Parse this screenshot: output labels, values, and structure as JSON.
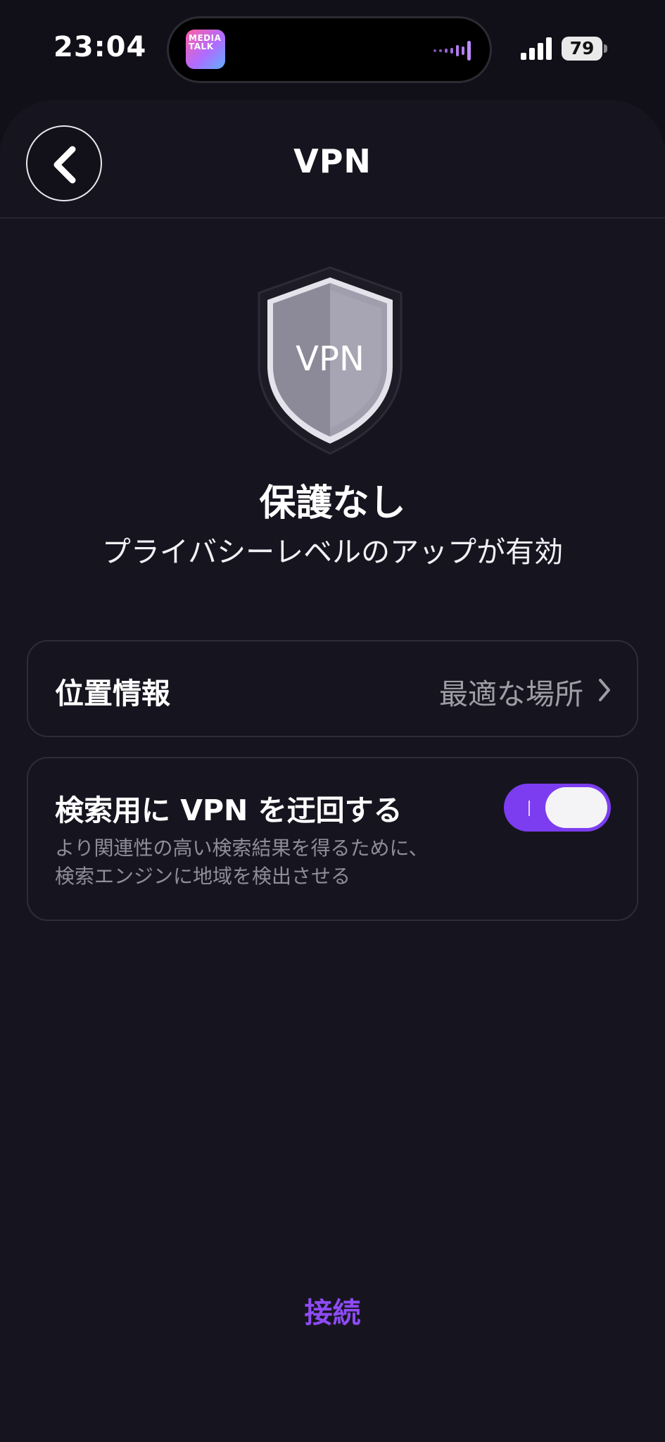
{
  "status_bar": {
    "time": "23:04",
    "battery": "79",
    "app_thumbnail_text": "MEDIA\nTALK"
  },
  "header": {
    "title": "VPN"
  },
  "shield": {
    "label": "VPN"
  },
  "status": {
    "title": "保護なし",
    "subtitle": "プライバシーレベルのアップが有効"
  },
  "location": {
    "label": "位置情報",
    "value": "最適な場所"
  },
  "bypass": {
    "title": "検索用に VPN を迂回する",
    "description": "より関連性の高い検索結果を得るために、\n検索エンジンに地域を検出させる",
    "enabled": true
  },
  "connect": {
    "label": "接続"
  },
  "colors": {
    "accent": "#7c3df0",
    "background": "#16151f"
  }
}
